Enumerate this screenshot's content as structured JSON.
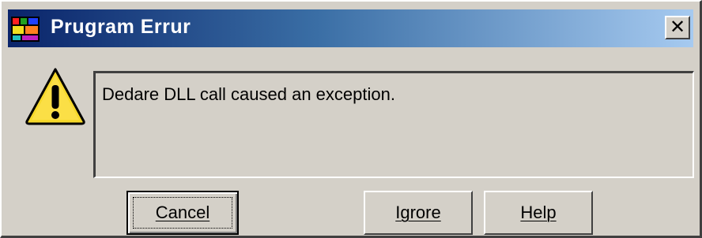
{
  "window": {
    "title": "Prugram Errur",
    "close_glyph": "✕",
    "app_icon": "app-icon"
  },
  "message": {
    "icon": "warning-icon",
    "text": "Dedare DLL call caused an exception."
  },
  "buttons": {
    "cancel": "Cancel",
    "ignore": "Igrore",
    "help": "Help"
  }
}
